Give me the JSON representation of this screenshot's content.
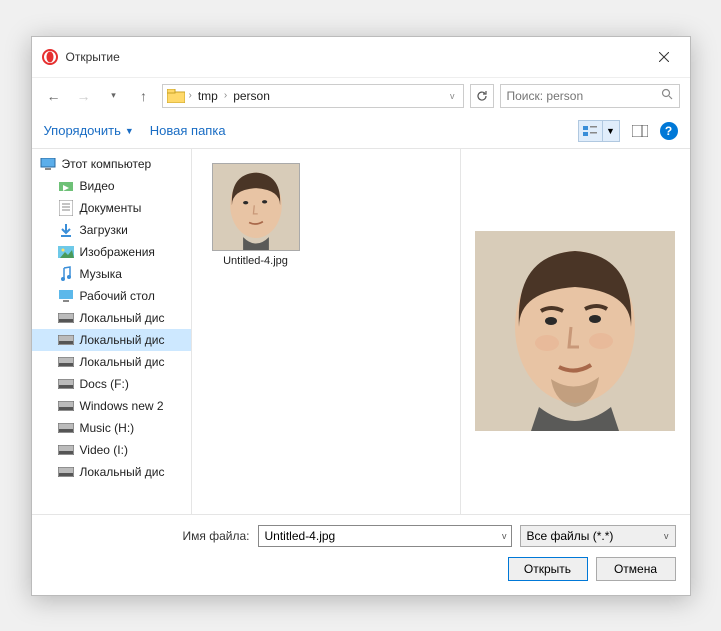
{
  "title": "Открытие",
  "breadcrumb": {
    "seg1": "tmp",
    "seg2": "person"
  },
  "search": {
    "placeholder": "Поиск: person"
  },
  "toolbar": {
    "organize": "Упорядочить",
    "new_folder": "Новая папка"
  },
  "sidebar": {
    "root": "Этот компьютер",
    "items": [
      "Видео",
      "Документы",
      "Загрузки",
      "Изображения",
      "Музыка",
      "Рабочий стол",
      "Локальный дис",
      "Локальный дис",
      "Локальный дис",
      "Docs (F:)",
      "Windows new 2",
      "Music (H:)",
      "Video (I:)",
      "Локальный дис"
    ],
    "selected_index": 7
  },
  "files": {
    "selected": {
      "name": "Untitled-4.jpg"
    }
  },
  "footer": {
    "filename_label": "Имя файла:",
    "filename_value": "Untitled-4.jpg",
    "filetype": "Все файлы (*.*)",
    "open": "Открыть",
    "cancel": "Отмена"
  }
}
